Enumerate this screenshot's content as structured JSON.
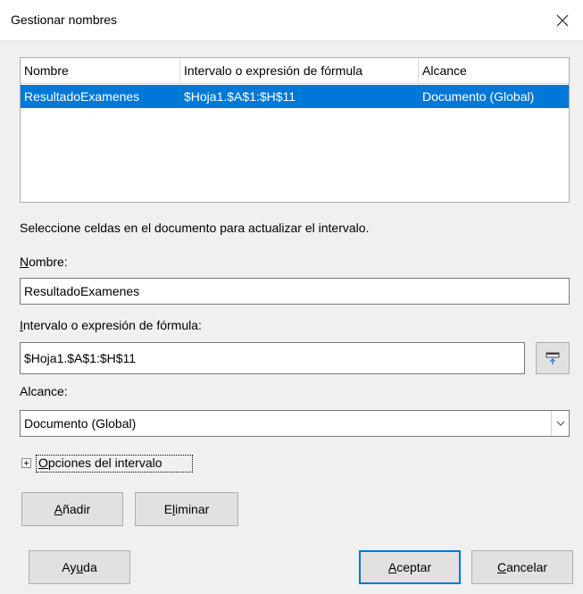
{
  "window": {
    "title": "Gestionar nombres"
  },
  "list": {
    "columns": [
      "Nombre",
      "Intervalo o expresión de fórmula",
      "Alcance"
    ],
    "rows": [
      {
        "name": "ResultadoExamenes",
        "range": "$Hoja1.$A$1:$H$11",
        "scope": "Documento (Global)",
        "selected": true
      }
    ]
  },
  "hint": "Seleccione celdas en el documento para actualizar el intervalo.",
  "name_field": {
    "label_pre": "",
    "label_acc": "N",
    "label_post": "ombre:",
    "value": "ResultadoExamenes"
  },
  "range_field": {
    "label_pre": "",
    "label_acc": "I",
    "label_post": "ntervalo o expresión de fórmula:",
    "value": "$Hoja1.$A$1:$H$11"
  },
  "scope_field": {
    "label": "Alcance:",
    "value": "Documento (Global)"
  },
  "options_expander": {
    "label_pre": "",
    "label_acc": "O",
    "label_post": "pciones del intervalo"
  },
  "buttons": {
    "add": {
      "pre": "",
      "acc": "A",
      "post": "ñadir"
    },
    "delete": {
      "pre": "E",
      "acc": "l",
      "post": "iminar"
    },
    "help": {
      "pre": "Ay",
      "acc": "u",
      "post": "da"
    },
    "ok": {
      "pre": "",
      "acc": "A",
      "post": "ceptar"
    },
    "cancel": {
      "pre": "",
      "acc": "C",
      "post": "ancelar"
    }
  },
  "colors": {
    "selection": "#0078d7",
    "dialog_bg": "#f0f0f0",
    "button_bg": "#e1e1e1"
  }
}
